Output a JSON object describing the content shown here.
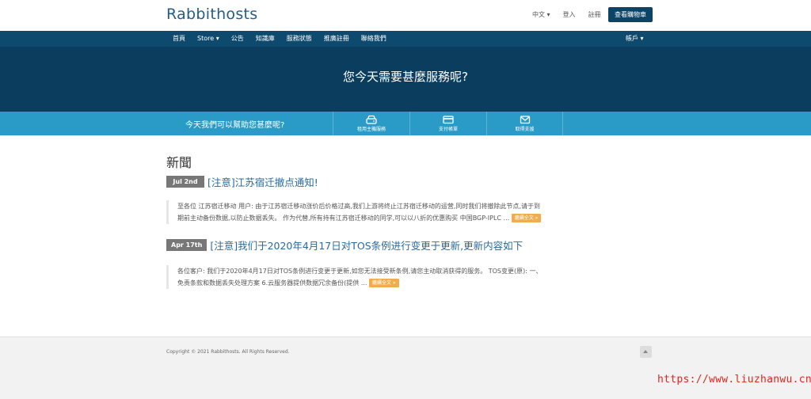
{
  "brand": {
    "name": "Rabbithosts"
  },
  "toplinks": {
    "language": "中文 ▾",
    "login": "登入",
    "register": "註冊",
    "cart": "查看購物車"
  },
  "nav": {
    "items": [
      "首頁",
      "Store ▾",
      "公告",
      "知識庫",
      "服務狀態",
      "推廣註冊",
      "聯絡我們"
    ],
    "account": "帳戶 ▾"
  },
  "hero": {
    "title": "您今天需要甚麼服務呢?"
  },
  "help": {
    "prompt": "今天我們可以幫助您甚麼呢?",
    "items": [
      {
        "label": "租用主機服務",
        "icon": "server-icon"
      },
      {
        "label": "支付帳單",
        "icon": "credit-card-icon"
      },
      {
        "label": "取得支援",
        "icon": "envelope-icon"
      }
    ]
  },
  "news": {
    "heading": "新聞",
    "items": [
      {
        "date": "Jul 2nd",
        "title": "[注意]江苏宿迁撤点通知!",
        "line1": "至各位  江苏宿迁移动  用户:    由于江苏宿迁移动涨价后价格过高,我们上游将终止江苏宿迁移动的运营,同时我们将撤除此节点,请于到",
        "line2": "期前主动备份数据,以防止数据丢失。  作为代替,所有持有江苏宿迁移动的同学,可以以八折的优惠购买 中国BGP-IPLC ...",
        "readmore": "繼續全文 »"
      },
      {
        "date": "Apr 17th",
        "title": "[注意]我们于2020年4月17日对TOS条例进行变更于更新,更新内容如下",
        "line1": "各位客户:  我们于2020年4月17日对TOS条例进行变更于更新,如您无法接受新条例,请您主动取消获得的服务。  TOS变更(原):  一、",
        "line2": "免责条款和数据丢失处理方案 6.云服务器提供数据冗余备份(提供 ...",
        "readmore": "繼續全文 »"
      }
    ]
  },
  "footer": {
    "copyright": "Copyright © 2021 Rabbithosts. All Rights Reserved."
  },
  "watermark": "https://www.liuzhanwu.cn",
  "colors": {
    "nav": "#0e4a6e",
    "hero": "#0b3d5e",
    "helpbar": "#2a9bc7",
    "readmore": "#f0ad4e",
    "brand": "#245d86"
  }
}
